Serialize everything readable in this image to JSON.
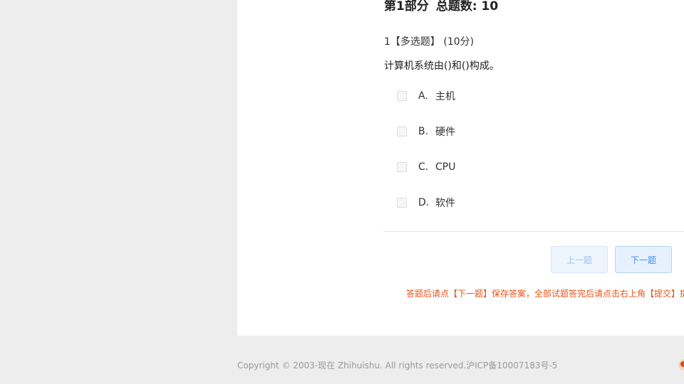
{
  "section": {
    "part_label": "第1部分",
    "total_label": "总题数: 10"
  },
  "question": {
    "number": "1",
    "type_label": "【多选题】",
    "score_label": "(10分)",
    "text": "计算机系统由()和()构成。",
    "options": [
      {
        "letter": "A.",
        "text": "主机",
        "checked": false
      },
      {
        "letter": "B.",
        "text": "硬件",
        "checked": false
      },
      {
        "letter": "C.",
        "text": "CPU",
        "checked": false
      },
      {
        "letter": "D.",
        "text": "软件",
        "checked": false
      }
    ]
  },
  "nav": {
    "prev_label": "上一题",
    "next_label": "下一题"
  },
  "notice": "答题后请点【下一题】保存答案，全部试题答完后请点击右上角【提交】提",
  "footer": "Copyright © 2003-现在 Zhihuishu. All rights reserved.沪ICP备10007183号-5",
  "colors": {
    "accent": "#3f8ee8",
    "notice": "#e8541e",
    "background": "#ededed"
  }
}
